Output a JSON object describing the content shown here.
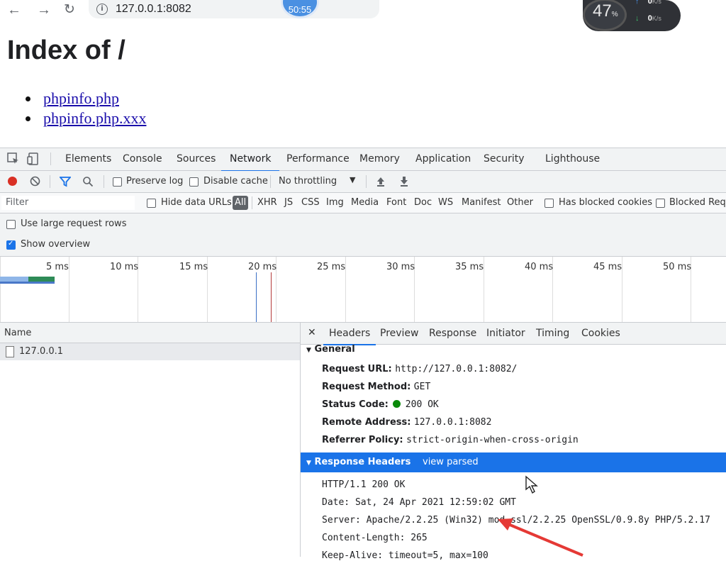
{
  "browser": {
    "url": "127.0.0.1:8082",
    "timer": "50:55",
    "speed_percent": "47",
    "speed_percent_unit": "%",
    "upload": "0",
    "download": "0",
    "speed_unit": "K/s"
  },
  "page": {
    "title": "Index of /",
    "files": [
      "phpinfo.php",
      "phpinfo.php.xxx"
    ]
  },
  "devtools": {
    "tabs": [
      "Elements",
      "Console",
      "Sources",
      "Network",
      "Performance",
      "Memory",
      "Application",
      "Security",
      "Lighthouse"
    ],
    "active_tab": "Network",
    "toolbar": {
      "preserve_log": "Preserve log",
      "disable_cache": "Disable cache",
      "throttling": "No throttling"
    },
    "filter": {
      "placeholder": "Filter",
      "hide_data_urls": "Hide data URLs",
      "all": "All",
      "types": [
        "XHR",
        "JS",
        "CSS",
        "Img",
        "Media",
        "Font",
        "Doc",
        "WS",
        "Manifest",
        "Other"
      ],
      "has_blocked_cookies": "Has blocked cookies",
      "blocked_requests": "Blocked Requ"
    },
    "options": {
      "large_rows": "Use large request rows",
      "show_overview": "Show overview"
    },
    "overview_ticks": [
      "5 ms",
      "10 ms",
      "15 ms",
      "20 ms",
      "25 ms",
      "30 ms",
      "35 ms",
      "40 ms",
      "45 ms",
      "50 ms"
    ],
    "requests": {
      "header": "Name",
      "rows": [
        "127.0.0.1"
      ]
    },
    "detail": {
      "tabs": [
        "Headers",
        "Preview",
        "Response",
        "Initiator",
        "Timing",
        "Cookies"
      ],
      "active_tab": "Headers",
      "general_title": "General",
      "general": [
        {
          "key": "Request URL:",
          "value": "http://127.0.0.1:8082/"
        },
        {
          "key": "Request Method:",
          "value": "GET"
        },
        {
          "key": "Status Code:",
          "value": "200 OK"
        },
        {
          "key": "Remote Address:",
          "value": "127.0.0.1:8082"
        },
        {
          "key": "Referrer Policy:",
          "value": "strict-origin-when-cross-origin"
        }
      ],
      "response_headers_title": "Response Headers",
      "view_parsed": "view parsed",
      "response_lines": [
        "HTTP/1.1 200 OK",
        "Date: Sat, 24 Apr 2021 12:59:02 GMT",
        "Server: Apache/2.2.25 (Win32) mod_ssl/2.2.25 OpenSSL/0.9.8y PHP/5.2.17",
        "Content-Length: 265",
        "Keep-Alive: timeout=5, max=100"
      ]
    }
  },
  "colors": {
    "accent": "#1a73e8",
    "status_ok": "#0a8a0a",
    "annotation_arrow": "#e53935"
  }
}
